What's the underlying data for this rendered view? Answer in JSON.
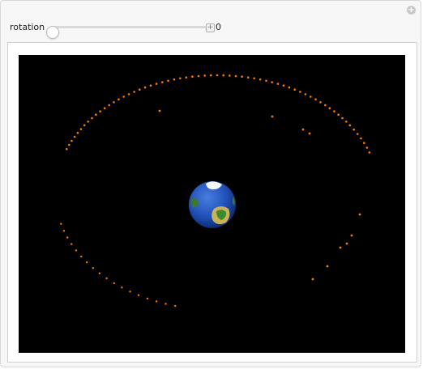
{
  "controls": {
    "rotation_label": "rotation",
    "rotation_value": "0",
    "stepper_symbol": "+",
    "add_symbol": "+"
  },
  "scene": {
    "background": "#000000",
    "orbit_color": "#ff7a00",
    "earth": {
      "ocean": "#1f4fb5",
      "land": "#3a7a2a",
      "ice": "#ffffff"
    }
  }
}
